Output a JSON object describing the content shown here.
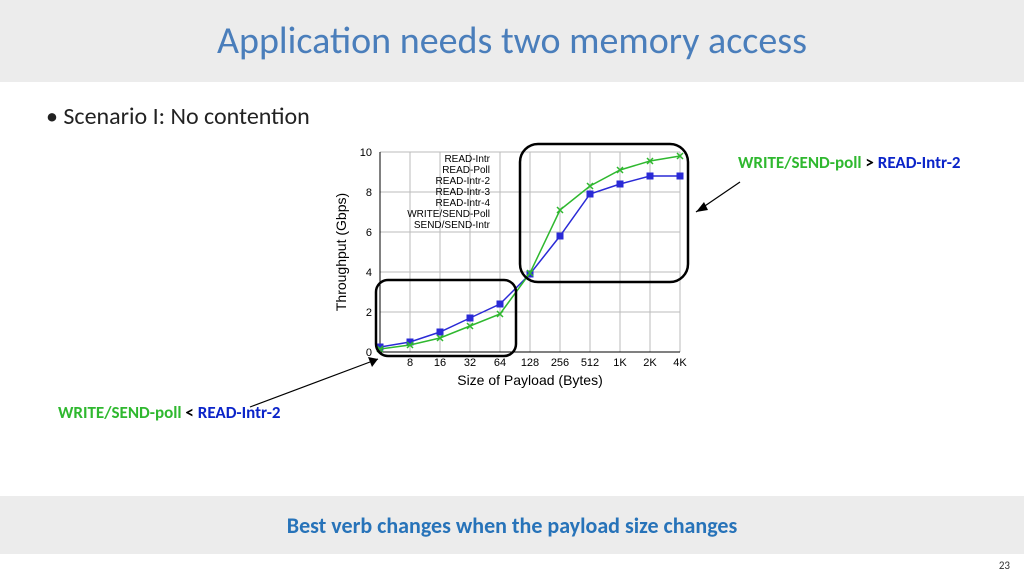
{
  "title": "Application needs two memory access",
  "bullet": "Scenario I: No contention",
  "annotation_right": {
    "part_green": "WRITE/SEND-poll",
    "part_sep": " > ",
    "part_blue": "READ-Intr-2"
  },
  "annotation_left": {
    "part_green": "WRITE/SEND-poll",
    "part_sep": " < ",
    "part_blue": "READ-Intr-2"
  },
  "footer": "Best verb changes when the payload size changes",
  "page_number": "23",
  "chart_data": {
    "type": "line",
    "title": "",
    "xlabel": "Size of Payload (Bytes)",
    "ylabel": "Throughput (Gbps)",
    "x_categories": [
      "8",
      "16",
      "32",
      "64",
      "128",
      "256",
      "512",
      "1K",
      "2K",
      "4K"
    ],
    "ylim": [
      0,
      10
    ],
    "yticks": [
      0,
      2,
      4,
      6,
      8,
      10
    ],
    "legend_entries": [
      "READ-Intr",
      "READ-Poll",
      "READ-Intr-2",
      "READ-Intr-3",
      "READ-Intr-4",
      "WRITE/SEND-Poll",
      "SEND/SEND-Intr"
    ],
    "series": [
      {
        "name": "READ-Intr-2",
        "color": "#2a2ad6",
        "marker": "square",
        "values": [
          0.25,
          0.5,
          1.0,
          1.7,
          2.4,
          3.9,
          5.8,
          7.9,
          8.4,
          8.8,
          8.8
        ]
      },
      {
        "name": "WRITE/SEND-Poll",
        "color": "#2fb82f",
        "marker": "x",
        "values": [
          0.15,
          0.35,
          0.7,
          1.3,
          1.9,
          3.95,
          7.1,
          8.3,
          9.1,
          9.55,
          9.8
        ]
      }
    ],
    "annotations": [
      {
        "text": "WRITE/SEND-poll > READ-Intr-2",
        "region_x": [
          "128",
          "4K"
        ]
      },
      {
        "text": "WRITE/SEND-poll < READ-Intr-2",
        "region_x": [
          "8",
          "64"
        ]
      }
    ]
  }
}
